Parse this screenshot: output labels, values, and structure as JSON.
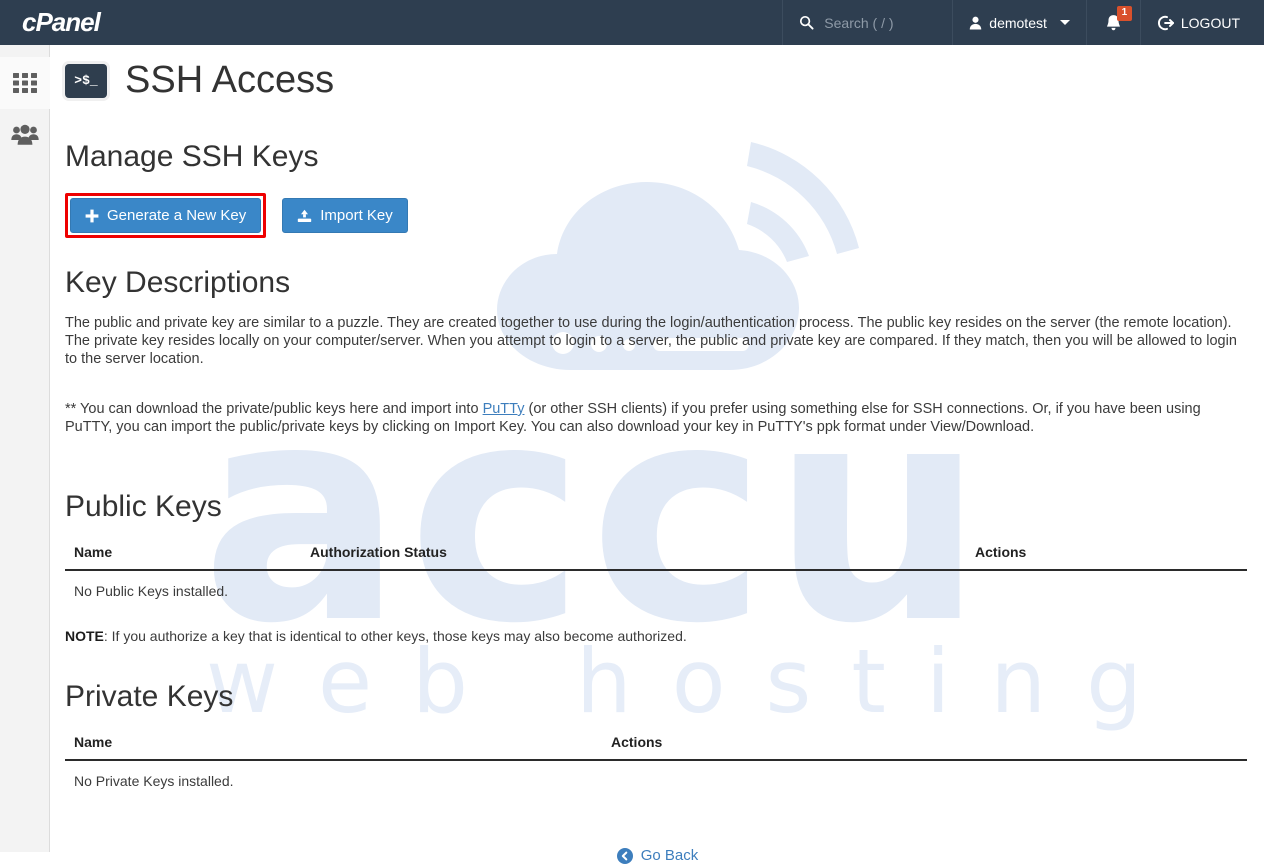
{
  "header": {
    "brand": "cPanel",
    "search": {
      "icon": "search-icon",
      "placeholder": "Search ( / )",
      "value": ""
    },
    "user": {
      "icon": "user-icon",
      "name": "demotest",
      "caret": "chevron-down-icon"
    },
    "notifications": {
      "icon": "bell-icon",
      "count": "1",
      "badge_color": "#d9512c"
    },
    "logout": {
      "icon": "logout-icon",
      "label": "LOGOUT"
    },
    "background_color": "#2e3e50"
  },
  "sidebar": {
    "items": [
      {
        "name": "apps-grid-icon",
        "label": "Apps"
      },
      {
        "name": "users-icon",
        "label": "Users"
      }
    ]
  },
  "watermark": {
    "line1": "accu",
    "line2": "web hosting",
    "color": "#e2eaf6"
  },
  "page": {
    "icon": "terminal-icon",
    "icon_text": ">$_",
    "title": "SSH Access"
  },
  "manage": {
    "heading": "Manage SSH Keys",
    "generate_button": {
      "label": "Generate a New Key",
      "icon": "plus-icon",
      "highlighted": true,
      "highlight_color": "#ee0000"
    },
    "import_button": {
      "label": "Import Key",
      "icon": "import-icon"
    },
    "button_color": "#3a87c8"
  },
  "descriptions": {
    "heading": "Key Descriptions",
    "paragraph1": "The public and private key are similar to a puzzle. They are created together to use during the login/authentication process. The public key resides on the server (the remote location). The private key resides locally on your computer/server. When you attempt to login to a server, the public and private key are compared. If they match, then you will be allowed to login to the server location.",
    "paragraph2_part1": "** You can download the private/public keys here and import into ",
    "paragraph2_link": "PuTTy",
    "paragraph2_part2": " (or other SSH clients) if you prefer using something else for SSH connections. Or, if you have been using PuTTY, you can import the public/private keys by clicking on Import Key. You can also download your key in PuTTY's ppk format under View/Download."
  },
  "public_keys": {
    "heading": "Public Keys",
    "columns": [
      "Name",
      "Authorization Status",
      "Actions"
    ],
    "empty_message": "No Public Keys installed.",
    "note_label": "NOTE",
    "note_text": ": If you authorize a key that is identical to other keys, those keys may also become authorized."
  },
  "private_keys": {
    "heading": "Private Keys",
    "columns": [
      "Name",
      "Actions"
    ],
    "empty_message": "No Private Keys installed."
  },
  "footer": {
    "go_back": {
      "label": "Go Back",
      "icon": "arrow-circle-left-icon"
    }
  }
}
